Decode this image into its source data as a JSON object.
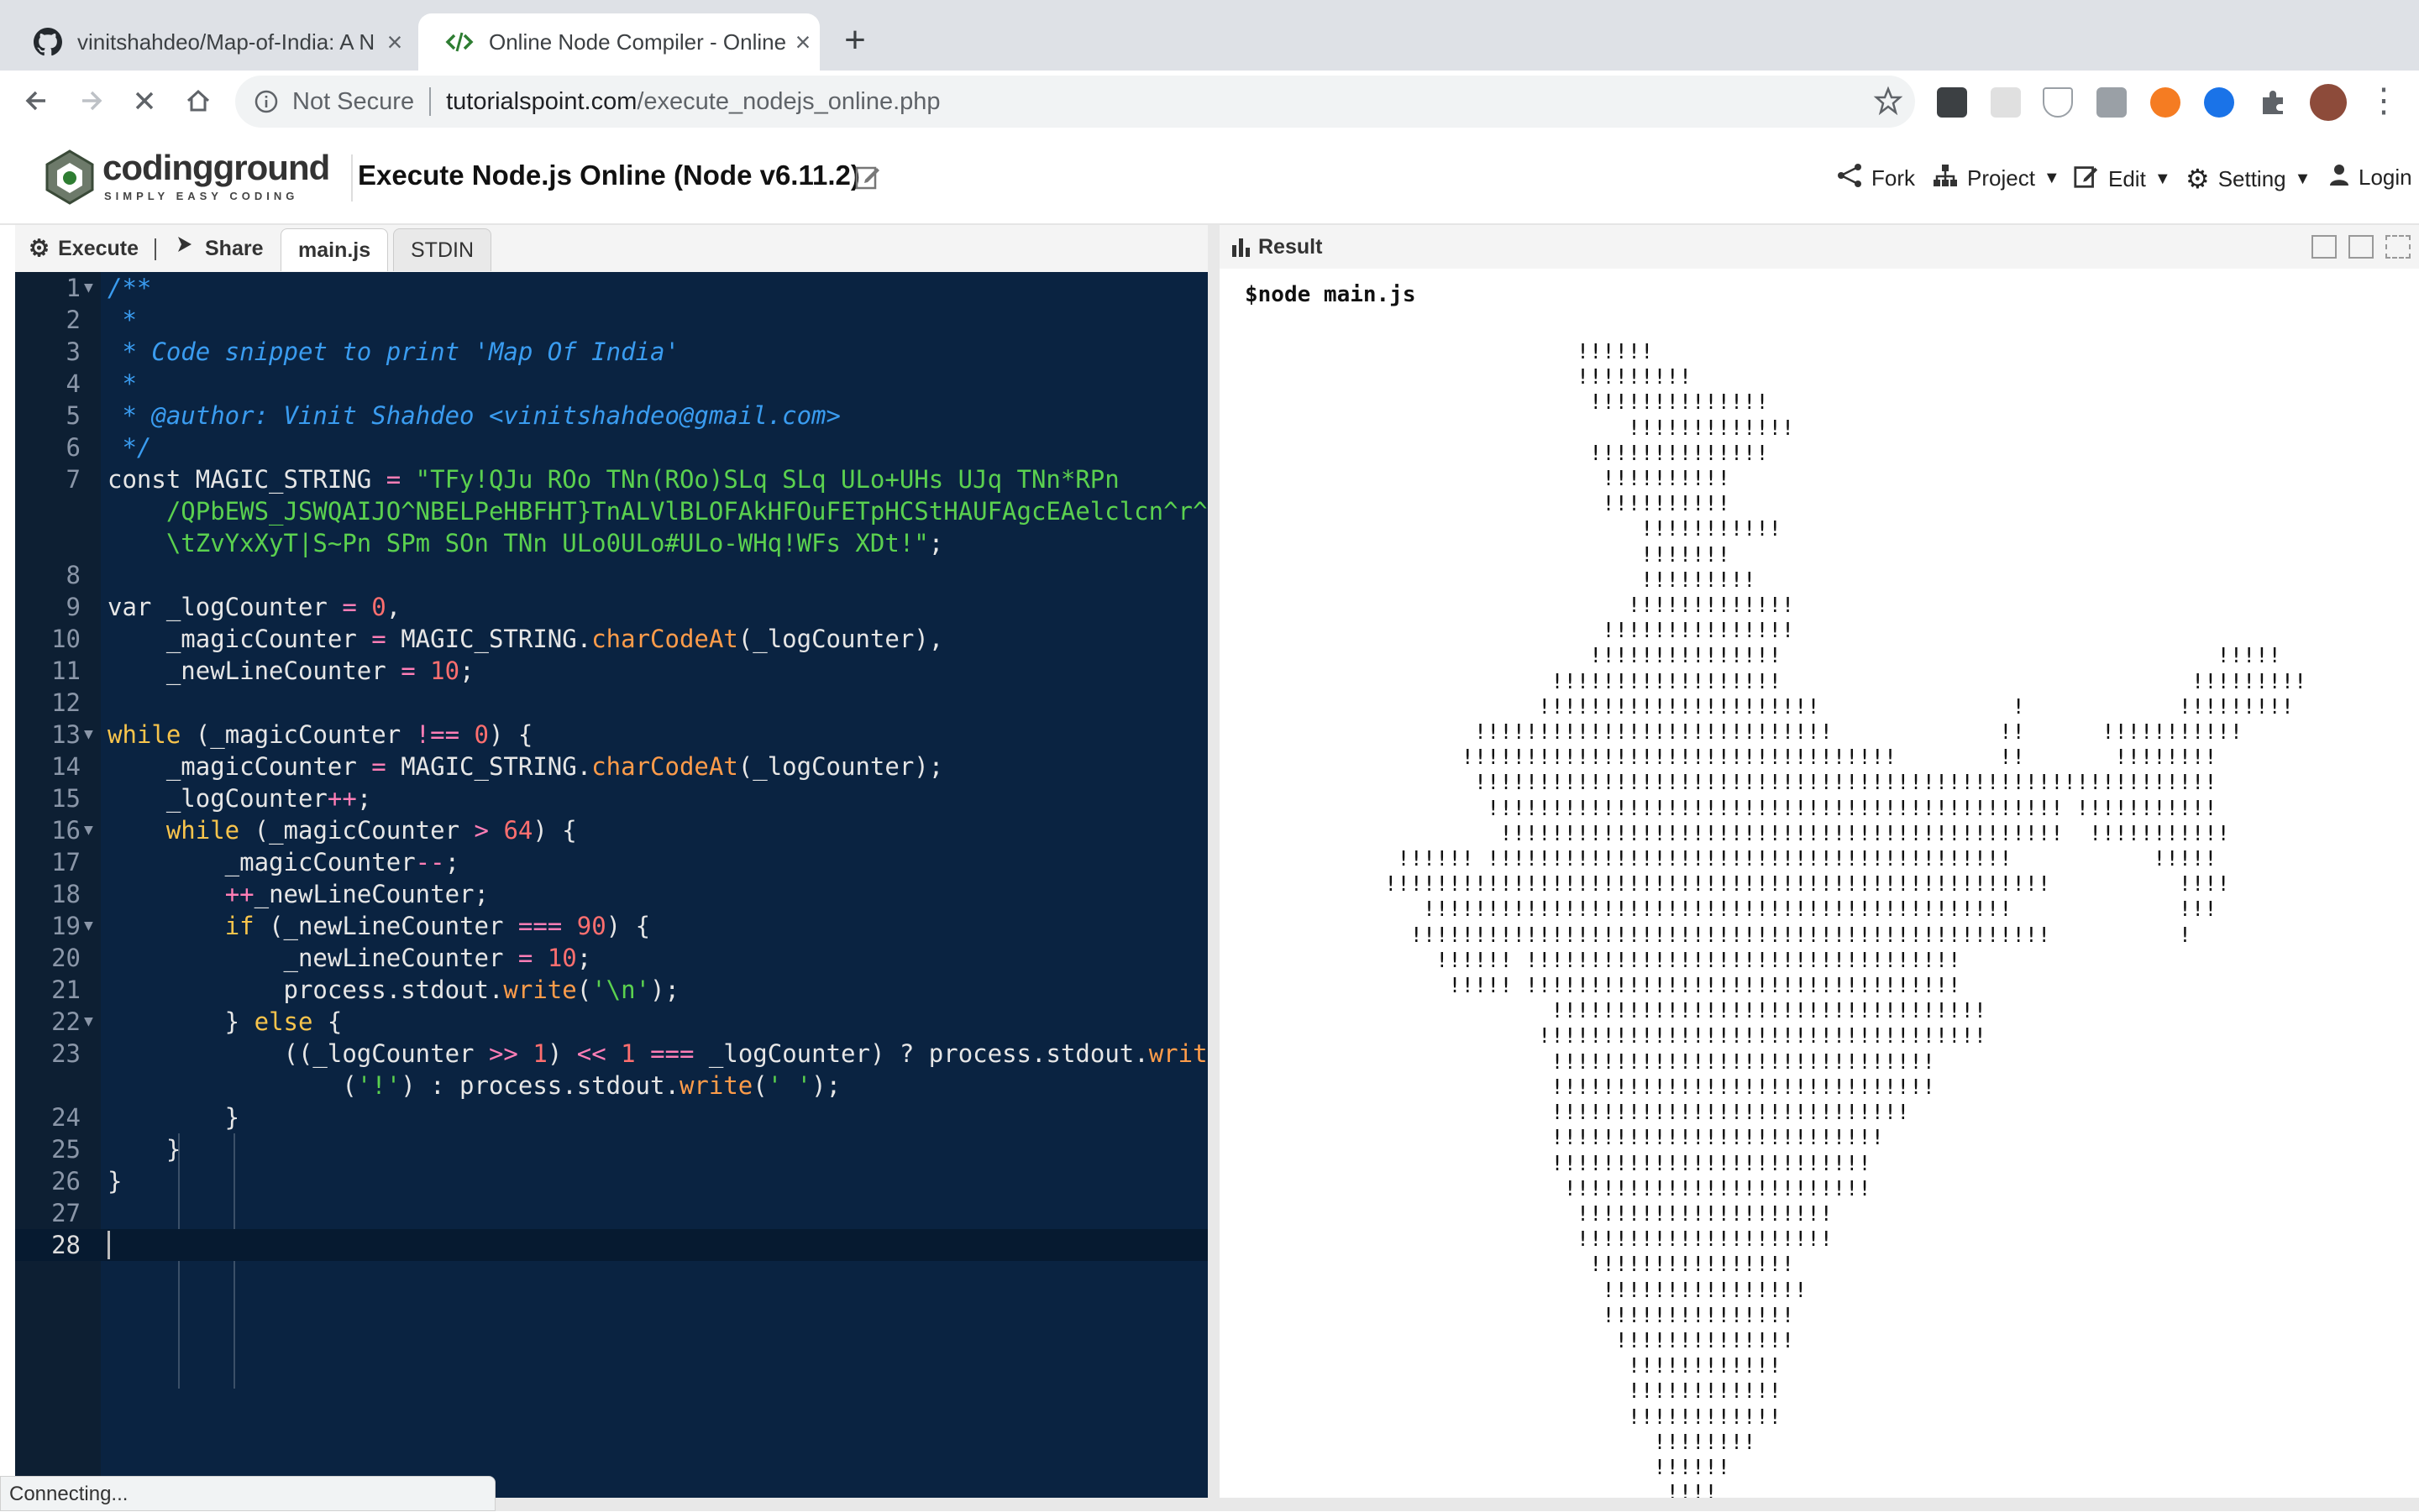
{
  "browser": {
    "tabs": [
      {
        "title": "vinitshahdeo/Map-of-India: A N",
        "icon": "github-icon",
        "active": false
      },
      {
        "title": "Online Node Compiler - Online",
        "icon": "code-brackets-icon",
        "active": true
      }
    ],
    "url_prefix": "Not Secure",
    "url_domain": "tutorialspoint.com",
    "url_path": "/execute_nodejs_online.php"
  },
  "site": {
    "logo_main": "codingground",
    "logo_tagline": "SIMPLY EASY CODING",
    "page_title": "Execute Node.js Online (Node v6.11.2)",
    "nav": {
      "fork": "Fork",
      "project": "Project",
      "edit": "Edit",
      "setting": "Setting",
      "login": "Login"
    }
  },
  "editor": {
    "execute_label": "Execute",
    "share_label": "Share",
    "tabs": [
      "main.js",
      "STDIN"
    ],
    "line_numbers": [
      "1",
      "2",
      "3",
      "4",
      "5",
      "6",
      "7",
      "8",
      "9",
      "10",
      "11",
      "12",
      "13",
      "14",
      "15",
      "16",
      "17",
      "18",
      "19",
      "20",
      "21",
      "22",
      "23",
      "24",
      "25",
      "26",
      "27",
      "28"
    ]
  },
  "result": {
    "header": "Result",
    "command": "$node main.js",
    "output": "                    !!!!!!\n                    !!!!!!!!!\n                     !!!!!!!!!!!!!!\n                        !!!!!!!!!!!!!\n                     !!!!!!!!!!!!!!\n                      !!!!!!!!!!\n                      !!!!!!!!!!\n                         !!!!!!!!!!!\n                         !!!!!!!\n                         !!!!!!!!!\n                        !!!!!!!!!!!!!\n                      !!!!!!!!!!!!!!!\n                     !!!!!!!!!!!!!!!                                  !!!!!\n                  !!!!!!!!!!!!!!!!!!                                !!!!!!!!!\n                 !!!!!!!!!!!!!!!!!!!!!!               !            !!!!!!!!!\n            !!!!!!!!!!!!!!!!!!!!!!!!!!!!             !!      !!!!!!!!!!!\n           !!!!!!!!!!!!!!!!!!!!!!!!!!!!!!!!!!        !!       !!!!!!!!\n            !!!!!!!!!!!!!!!!!!!!!!!!!!!!!!!!!!!!!!!!!!!!!!!!!!!!!!!!!!\n             !!!!!!!!!!!!!!!!!!!!!!!!!!!!!!!!!!!!!!!!!!!!! !!!!!!!!!!!\n              !!!!!!!!!!!!!!!!!!!!!!!!!!!!!!!!!!!!!!!!!!!!  !!!!!!!!!!!\n      !!!!!! !!!!!!!!!!!!!!!!!!!!!!!!!!!!!!!!!!!!!!!!!           !!!!!\n     !!!!!!!!!!!!!!!!!!!!!!!!!!!!!!!!!!!!!!!!!!!!!!!!!!!!          !!!!\n        !!!!!!!!!!!!!!!!!!!!!!!!!!!!!!!!!!!!!!!!!!!!!!             !!!\n       !!!!!!!!!!!!!!!!!!!!!!!!!!!!!!!!!!!!!!!!!!!!!!!!!!          !\n         !!!!!! !!!!!!!!!!!!!!!!!!!!!!!!!!!!!!!!!!\n          !!!!! !!!!!!!!!!!!!!!!!!!!!!!!!!!!!!!!!!\n                  !!!!!!!!!!!!!!!!!!!!!!!!!!!!!!!!!!\n                 !!!!!!!!!!!!!!!!!!!!!!!!!!!!!!!!!!!\n                  !!!!!!!!!!!!!!!!!!!!!!!!!!!!!!\n                  !!!!!!!!!!!!!!!!!!!!!!!!!!!!!!\n                  !!!!!!!!!!!!!!!!!!!!!!!!!!!!\n                  !!!!!!!!!!!!!!!!!!!!!!!!!!\n                  !!!!!!!!!!!!!!!!!!!!!!!!!\n                   !!!!!!!!!!!!!!!!!!!!!!!!\n                    !!!!!!!!!!!!!!!!!!!!\n                    !!!!!!!!!!!!!!!!!!!!\n                     !!!!!!!!!!!!!!!!\n                      !!!!!!!!!!!!!!!!\n                      !!!!!!!!!!!!!!!\n                       !!!!!!!!!!!!!!\n                        !!!!!!!!!!!!\n                        !!!!!!!!!!!!\n                        !!!!!!!!!!!!\n                          !!!!!!!!\n                          !!!!!!\n                           !!!!"
  },
  "status": {
    "text": "Connecting..."
  },
  "colors": {
    "editor_bg": "#0a2341",
    "comment": "#3a9cf0",
    "keyword": "#f8c44c",
    "string": "#5bd14f",
    "number": "#ff6f6f"
  }
}
